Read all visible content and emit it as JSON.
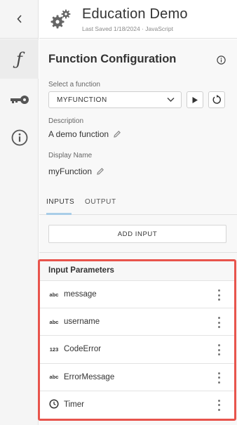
{
  "header": {
    "title": "Education Demo",
    "subtitle": "Last Saved 1/18/2024 · JavaScript",
    "icon": "gears-icon"
  },
  "rail": {
    "items": [
      {
        "icon": "back-chevron-icon"
      },
      {
        "icon": "function-icon",
        "glyph": "ƒ",
        "active": true
      },
      {
        "icon": "key-icon"
      },
      {
        "icon": "info-icon"
      }
    ]
  },
  "config": {
    "title": "Function Configuration",
    "select_label": "Select a function",
    "select_value": "MYFUNCTION",
    "description_label": "Description",
    "description_value": "A demo function",
    "display_name_label": "Display Name",
    "display_name_value": "myFunction",
    "tabs": [
      {
        "label": "INPUTS",
        "active": true
      },
      {
        "label": "OUTPUT",
        "active": false
      }
    ],
    "add_input_label": "ADD INPUT"
  },
  "params": {
    "title": "Input Parameters",
    "items": [
      {
        "type": "abc",
        "name": "message"
      },
      {
        "type": "abc",
        "name": "username"
      },
      {
        "type": "123",
        "name": "CodeError"
      },
      {
        "type": "abc",
        "name": "ErrorMessage"
      },
      {
        "type": "clock",
        "name": "Timer"
      }
    ]
  },
  "colors": {
    "highlight_border": "#e8544c",
    "tab_underline": "#a9cde8"
  }
}
